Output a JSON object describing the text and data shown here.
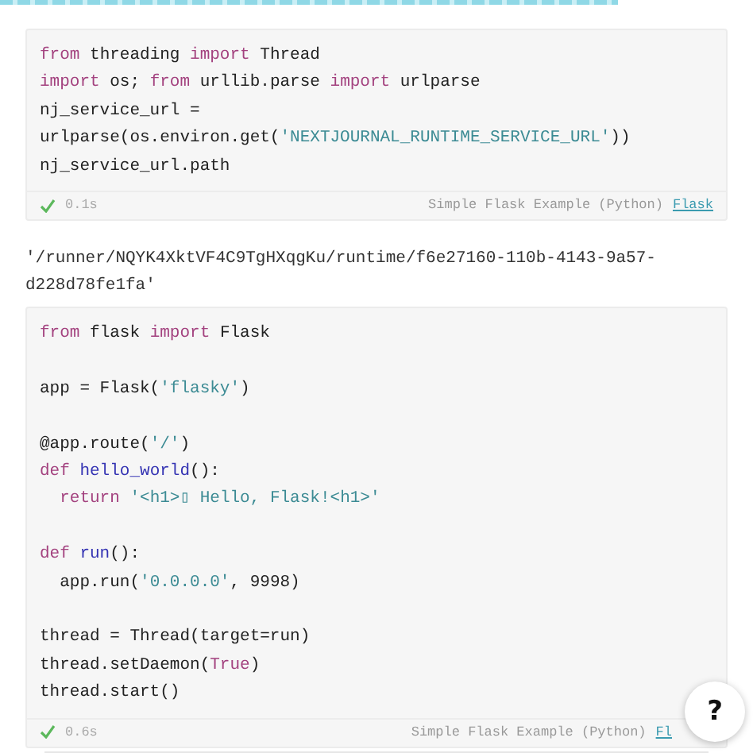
{
  "progress": {
    "level": 0.82
  },
  "cells": [
    {
      "blocks": [
        {
          "lines": [
            [
              {
                "kind": "kw",
                "t": "from"
              },
              {
                "kind": "p",
                "t": " threading "
              },
              {
                "kind": "kw",
                "t": "import"
              },
              {
                "kind": "p",
                "t": " Thread"
              }
            ],
            [
              {
                "kind": "kw",
                "t": "import"
              },
              {
                "kind": "p",
                "t": " os; "
              },
              {
                "kind": "kw",
                "t": "from"
              },
              {
                "kind": "p",
                "t": " urllib.parse "
              },
              {
                "kind": "kw",
                "t": "import"
              },
              {
                "kind": "p",
                "t": " urlparse"
              }
            ],
            [
              {
                "kind": "p",
                "t": "nj_service_url ="
              }
            ],
            [
              {
                "kind": "p",
                "t": "urlparse(os.environ.get("
              },
              {
                "kind": "str",
                "t": "'NEXTJOURNAL_RUNTIME_SERVICE_URL'"
              },
              {
                "kind": "p",
                "t": "))"
              }
            ],
            [
              {
                "kind": "p",
                "t": "nj_service_url.path"
              }
            ]
          ]
        }
      ],
      "status": {
        "ok": true,
        "time": "0.1s",
        "runtime": "Simple Flask Example (Python)",
        "link": "Flask"
      },
      "output": "'/runner/NQYK4XktVF4C9TgHXqgKu/runtime/f6e27160-110b-4143-9a57-d228d78fe1fa'"
    },
    {
      "blocks": [
        {
          "lines": [
            [
              {
                "kind": "kw",
                "t": "from"
              },
              {
                "kind": "p",
                "t": " flask "
              },
              {
                "kind": "kw",
                "t": "import"
              },
              {
                "kind": "p",
                "t": " Flask"
              }
            ]
          ]
        },
        {
          "lines": [
            [
              {
                "kind": "p",
                "t": "app = Flask("
              },
              {
                "kind": "str",
                "t": "'flasky'"
              },
              {
                "kind": "p",
                "t": ")"
              }
            ]
          ]
        },
        {
          "lines": [
            [
              {
                "kind": "p",
                "t": "@app.route("
              },
              {
                "kind": "str",
                "t": "'/'"
              },
              {
                "kind": "p",
                "t": ")"
              }
            ],
            [
              {
                "kind": "kw",
                "t": "def"
              },
              {
                "kind": "fn",
                "t": " hello_world"
              },
              {
                "kind": "p",
                "t": "():"
              }
            ],
            [
              {
                "kind": "kw",
                "t": "  return"
              },
              {
                "kind": "str",
                "t": " '<h1>▯ Hello, Flask!<h1>'"
              }
            ]
          ]
        },
        {
          "lines": [
            [
              {
                "kind": "kw",
                "t": "def"
              },
              {
                "kind": "fn",
                "t": " run"
              },
              {
                "kind": "p",
                "t": "():"
              }
            ],
            [
              {
                "kind": "p",
                "t": "  app.run("
              },
              {
                "kind": "str",
                "t": "'0.0.0.0'"
              },
              {
                "kind": "p",
                "t": ", 9998)"
              }
            ]
          ]
        },
        {
          "lines": [
            [
              {
                "kind": "p",
                "t": "thread = Thread(target=run)"
              }
            ],
            [
              {
                "kind": "p",
                "t": "thread.setDaemon("
              },
              {
                "kind": "kw",
                "t": "True"
              },
              {
                "kind": "p",
                "t": ")"
              }
            ],
            [
              {
                "kind": "p",
                "t": "thread.start()"
              }
            ]
          ]
        }
      ],
      "status": {
        "ok": true,
        "time": "0.6s",
        "runtime": "Simple Flask Example (Python)",
        "link": "Fl"
      }
    }
  ],
  "help_button": "?"
}
